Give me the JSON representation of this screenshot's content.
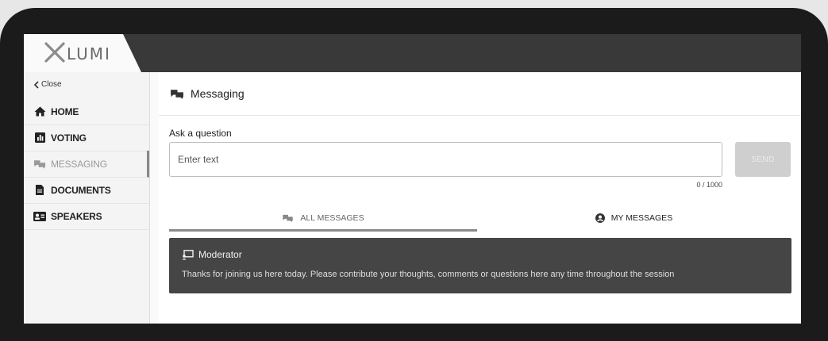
{
  "app": {
    "logo_text": "LUMI"
  },
  "sidebar": {
    "close_label": "Close",
    "items": [
      {
        "label": "HOME",
        "icon": "home-icon"
      },
      {
        "label": "VOTING",
        "icon": "bar-chart-icon"
      },
      {
        "label": "MESSAGING",
        "icon": "chat-icon",
        "active": true
      },
      {
        "label": "DOCUMENTS",
        "icon": "document-icon"
      },
      {
        "label": "SPEAKERS",
        "icon": "id-card-icon"
      }
    ]
  },
  "messaging": {
    "header_title": "Messaging",
    "ask_label": "Ask a question",
    "input_placeholder": "Enter text",
    "counter": "0 / 1000",
    "send_label": "SEND",
    "tabs": {
      "all": "ALL MESSAGES",
      "mine": "MY MESSAGES"
    },
    "message": {
      "author": "Moderator",
      "text": "Thanks for joining us here today. Please contribute your thoughts, comments or questions here any time throughout the session"
    }
  },
  "colors": {
    "topbar": "#393939",
    "card": "#454545",
    "send_disabled": "#cfcfcf"
  }
}
